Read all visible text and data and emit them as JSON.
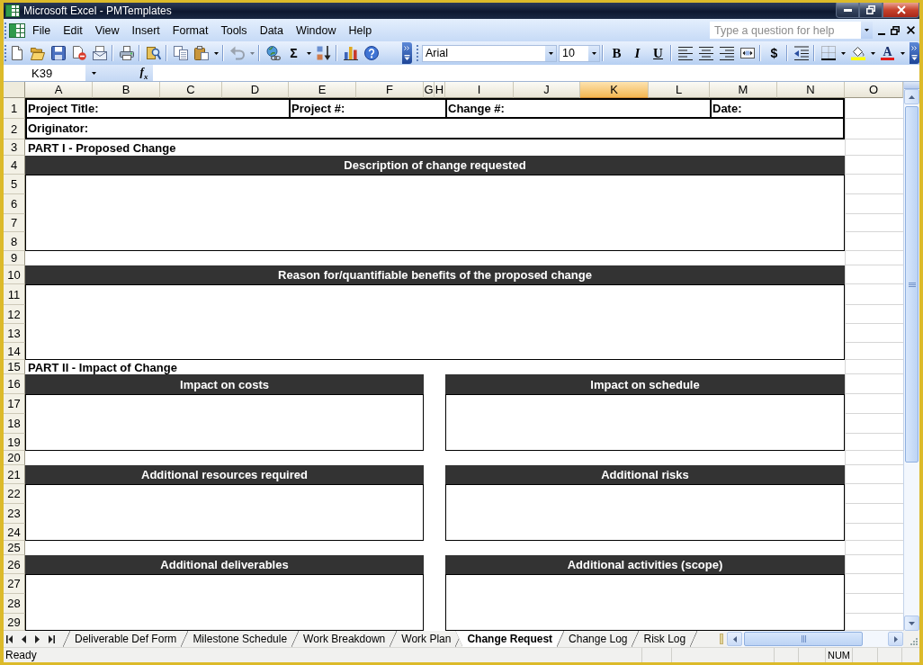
{
  "window": {
    "title": "Microsoft Excel - PMTemplates"
  },
  "menu_bar": {
    "items": [
      "File",
      "Edit",
      "View",
      "Insert",
      "Format",
      "Tools",
      "Data",
      "Window",
      "Help"
    ],
    "help_search": {
      "placeholder": "Type a question for help"
    }
  },
  "standard_toolbar": {
    "groups": [
      {
        "buttons": [
          {
            "kind": "new",
            "disabled": false
          },
          {
            "kind": "open",
            "disabled": false
          },
          {
            "kind": "save",
            "disabled": false
          },
          {
            "kind": "permission",
            "disabled": false
          },
          {
            "kind": "email",
            "disabled": false
          }
        ]
      },
      {
        "buttons": [
          {
            "kind": "print",
            "disabled": false
          }
        ]
      },
      {
        "buttons": [
          {
            "kind": "research",
            "disabled": false
          }
        ]
      },
      {
        "buttons": [
          {
            "kind": "copy",
            "disabled": false
          },
          {
            "kind": "paste",
            "disabled": false
          }
        ]
      },
      {
        "buttons": [
          {
            "kind": "undo",
            "disabled": true
          }
        ]
      },
      {
        "buttons": [
          {
            "kind": "hyperlink",
            "disabled": false
          },
          {
            "kind": "autosum",
            "label": "Σ",
            "disabled": false
          },
          {
            "kind": "sort",
            "disabled": false
          }
        ]
      },
      {
        "buttons": [
          {
            "kind": "chart",
            "disabled": false
          },
          {
            "kind": "help",
            "disabled": false
          }
        ]
      }
    ]
  },
  "formatting_toolbar": {
    "font": "Arial",
    "font_size": "10",
    "groups": [
      {
        "buttons": [
          {
            "kind": "bold",
            "label": "B"
          },
          {
            "kind": "italic",
            "label": "I"
          },
          {
            "kind": "underline",
            "label": "U"
          }
        ]
      },
      {
        "buttons": [
          {
            "kind": "align_left"
          },
          {
            "kind": "align_center"
          },
          {
            "kind": "align_right"
          },
          {
            "kind": "merge"
          }
        ]
      },
      {
        "buttons": [
          {
            "kind": "currency",
            "label": "$"
          }
        ]
      },
      {
        "buttons": [
          {
            "kind": "indent"
          }
        ]
      },
      {
        "buttons": [
          {
            "kind": "borders"
          },
          {
            "kind": "fill_color"
          },
          {
            "kind": "font_color",
            "label": "A"
          }
        ]
      }
    ]
  },
  "formula_bar": {
    "name_box": "K39",
    "function_label": "f$_{x}$"
  },
  "worksheet": {
    "column_headers": [
      {
        "label": "A",
        "selected": false
      },
      {
        "label": "B",
        "selected": false
      },
      {
        "label": "C",
        "selected": false
      },
      {
        "label": "D",
        "selected": false
      },
      {
        "label": "E",
        "selected": false
      },
      {
        "label": "F",
        "selected": false
      },
      {
        "label": "G",
        "selected": false
      },
      {
        "label": "H",
        "selected": false
      },
      {
        "label": "I",
        "selected": false
      },
      {
        "label": "J",
        "selected": false
      },
      {
        "label": "K",
        "selected": true
      },
      {
        "label": "L",
        "selected": false
      },
      {
        "label": "M",
        "selected": false
      },
      {
        "label": "N",
        "selected": false
      },
      {
        "label": "O",
        "selected": false
      }
    ],
    "row_headers": [
      "1",
      "2",
      "3",
      "4",
      "5",
      "6",
      "7",
      "8",
      "9",
      "10",
      "11",
      "12",
      "13",
      "14",
      "15",
      "16",
      "17",
      "18",
      "19",
      "20",
      "21",
      "22",
      "23",
      "24",
      "25",
      "26",
      "27",
      "28",
      "29"
    ],
    "form": [
      {
        "kind": "fields",
        "fields": [
          "Project Title:",
          "Project #:",
          "Change #:",
          "Date:"
        ]
      },
      {
        "kind": "fields",
        "fields": [
          "Originator:"
        ]
      },
      {
        "kind": "section",
        "text": "PART I - Proposed Change"
      },
      {
        "kind": "panel",
        "titles": [
          "Description of change requested"
        ]
      },
      {
        "kind": "panel",
        "titles": [
          "Reason for/quantifiable benefits of the proposed change"
        ]
      },
      {
        "kind": "section",
        "text": "PART II - Impact of Change"
      },
      {
        "kind": "panel",
        "titles": [
          "Impact on costs",
          "Impact on schedule"
        ]
      },
      {
        "kind": "panel",
        "titles": [
          "Additional resources required",
          "Additional risks"
        ]
      },
      {
        "kind": "panel",
        "titles": [
          "Additional deliverables",
          "Additional activities (scope)"
        ]
      }
    ]
  },
  "sheet_tabs": [
    {
      "label": "Deliverable Def Form",
      "selected": false
    },
    {
      "label": "Milestone Schedule",
      "selected": false
    },
    {
      "label": "Work Breakdown",
      "selected": false
    },
    {
      "label": "Work Plan",
      "selected": false
    },
    {
      "label": "Change Request",
      "selected": true
    },
    {
      "label": "Change Log",
      "selected": false
    },
    {
      "label": "Risk Log",
      "selected": false
    }
  ],
  "status_bar": {
    "status": "Ready",
    "panels": [
      {
        "kind": "blank"
      },
      {
        "kind": "blank"
      },
      {
        "kind": "blank"
      },
      {
        "kind": "blank"
      },
      {
        "kind": "indicator",
        "text": "NUM"
      },
      {
        "kind": "blank"
      },
      {
        "kind": "blank"
      },
      {
        "kind": "blank"
      }
    ]
  }
}
